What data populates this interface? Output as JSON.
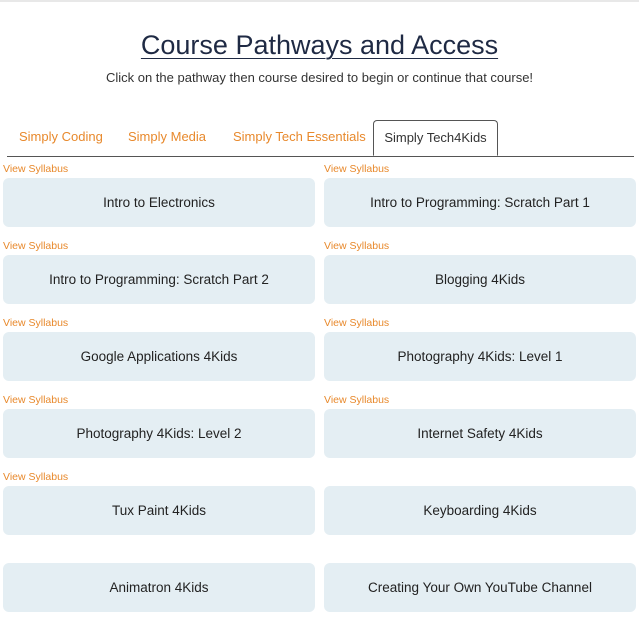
{
  "header": {
    "title": "Course Pathways and Access",
    "subtitle": "Click on the pathway then course desired to begin or continue that course!"
  },
  "tabs": [
    {
      "label": "Simply Coding"
    },
    {
      "label": "Simply Media"
    },
    {
      "label": "Simply Tech Essentials"
    },
    {
      "label": "Simply Tech4Kids",
      "active": true
    }
  ],
  "syllabus_label": "View Syllabus",
  "courses": [
    {
      "title": "Intro to Electronics"
    },
    {
      "title": "Intro to Programming: Scratch Part 1"
    },
    {
      "title": "Intro to Programming: Scratch Part 2"
    },
    {
      "title": "Blogging 4Kids"
    },
    {
      "title": "Google Applications 4Kids"
    },
    {
      "title": "Photography 4Kids: Level 1"
    },
    {
      "title": "Photography 4Kids: Level 2"
    },
    {
      "title": "Internet Safety 4Kids"
    },
    {
      "title": "Tux Paint 4Kids"
    },
    {
      "title": "Keyboarding 4Kids"
    },
    {
      "title": "Animatron 4Kids"
    },
    {
      "title": "Creating Your Own YouTube Channel"
    }
  ],
  "colors": {
    "accent": "#e8892c",
    "card_background": "#e4eef3",
    "title": "#1f2a44"
  }
}
